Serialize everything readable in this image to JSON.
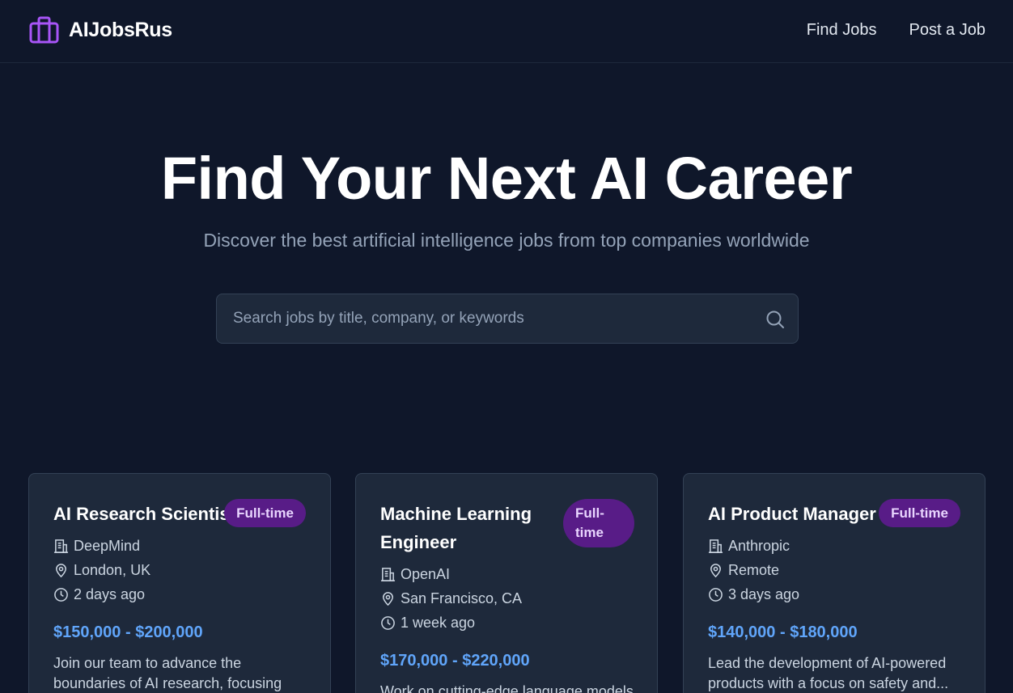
{
  "header": {
    "brand": "AIJobsRus",
    "nav": [
      "Find Jobs",
      "Post a Job"
    ]
  },
  "hero": {
    "title": "Find Your Next AI Career",
    "subtitle": "Discover the best artificial intelligence jobs from top companies worldwide",
    "search_placeholder": "Search jobs by title, company, or keywords"
  },
  "colors": {
    "background": "#0f172a",
    "card": "#1e293b",
    "accent_purple": "#a855f7",
    "badge_bg": "#581c87",
    "salary": "#60a5fa"
  },
  "jobs": [
    {
      "title": "AI Research Scientist",
      "type": "Full-time",
      "company": "DeepMind",
      "location": "London, UK",
      "posted": "2 days ago",
      "salary": "$150,000 - $200,000",
      "description": "Join our team to advance the boundaries of AI research, focusing on..."
    },
    {
      "title": "Machine Learning Engineer",
      "type": "Full-time",
      "company": "OpenAI",
      "location": "San Francisco, CA",
      "posted": "1 week ago",
      "salary": "$170,000 - $220,000",
      "description": "Work on cutting-edge language models"
    },
    {
      "title": "AI Product Manager",
      "type": "Full-time",
      "company": "Anthropic",
      "location": "Remote",
      "posted": "3 days ago",
      "salary": "$140,000 - $180,000",
      "description": "Lead the development of AI-powered products with a focus on safety and..."
    }
  ]
}
